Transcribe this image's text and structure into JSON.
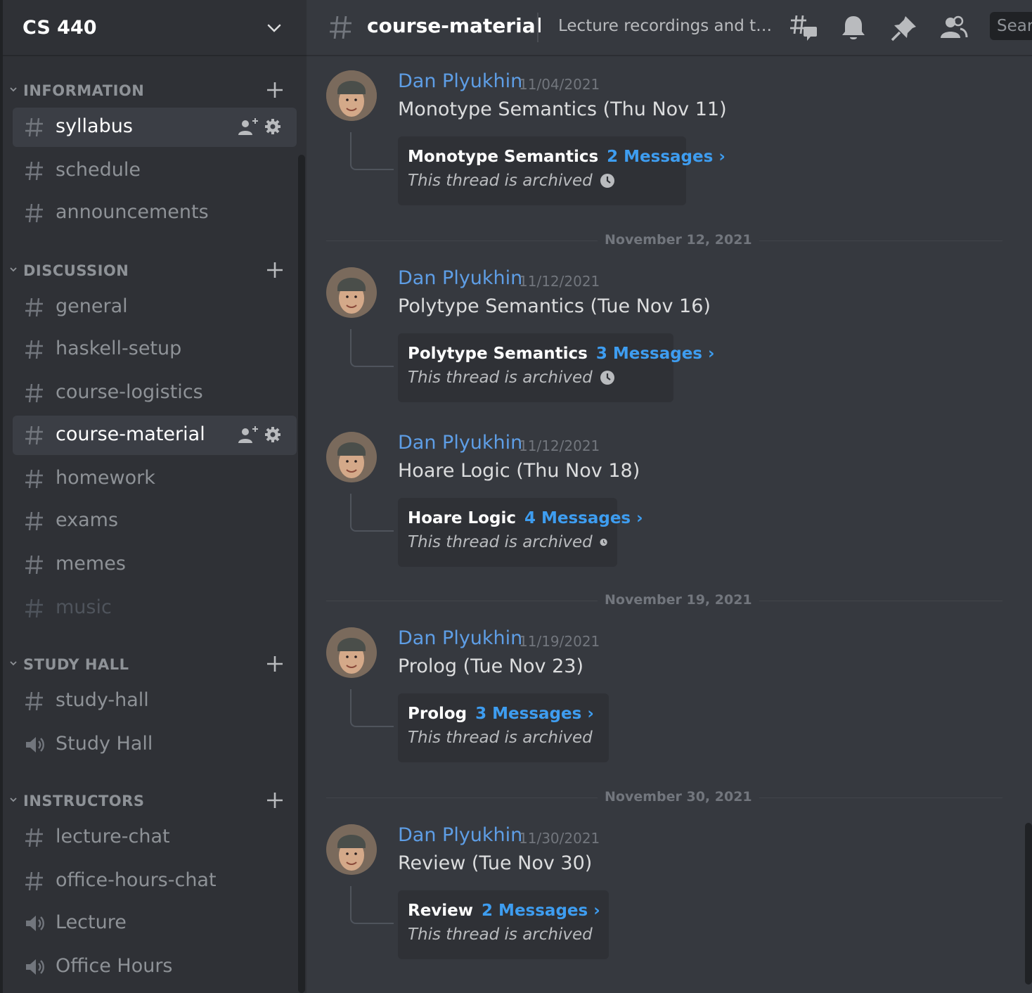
{
  "guild": {
    "name": "CS 440"
  },
  "sidebar": {
    "categories": [
      {
        "label": "INFORMATION",
        "channels": [
          {
            "label": "syllabus",
            "type": "text",
            "state": "selected"
          },
          {
            "label": "schedule",
            "type": "text"
          },
          {
            "label": "announcements",
            "type": "text"
          }
        ]
      },
      {
        "label": "DISCUSSION",
        "channels": [
          {
            "label": "general",
            "type": "text"
          },
          {
            "label": "haskell-setup",
            "type": "text"
          },
          {
            "label": "course-logistics",
            "type": "text"
          },
          {
            "label": "course-material",
            "type": "text",
            "state": "active"
          },
          {
            "label": "homework",
            "type": "text"
          },
          {
            "label": "exams",
            "type": "text"
          },
          {
            "label": "memes",
            "type": "text"
          },
          {
            "label": "music",
            "type": "text",
            "state": "muted"
          }
        ]
      },
      {
        "label": "STUDY HALL",
        "channels": [
          {
            "label": "study-hall",
            "type": "text"
          },
          {
            "label": "Study Hall",
            "type": "voice"
          }
        ]
      },
      {
        "label": "INSTRUCTORS",
        "channels": [
          {
            "label": "lecture-chat",
            "type": "text"
          },
          {
            "label": "office-hours-chat",
            "type": "text"
          },
          {
            "label": "Lecture",
            "type": "voice"
          },
          {
            "label": "Office Hours",
            "type": "voice"
          }
        ]
      }
    ]
  },
  "topbar": {
    "channel_name": "course-material",
    "topic": "Lecture recordings and topi...",
    "search_placeholder": "Search",
    "icons": [
      "threads-icon",
      "bell-icon",
      "pin-icon",
      "members-icon"
    ]
  },
  "messages": [
    {
      "author": "Dan Plyukhin",
      "timestamp": "11/04/2021",
      "content": "Monotype Semantics (Thu Nov 11)",
      "thread": {
        "name": "Monotype Semantics",
        "count": "2 Messages ›",
        "status": "This thread is archived"
      }
    },
    {
      "date_separator": "November 12, 2021"
    },
    {
      "author": "Dan Plyukhin",
      "timestamp": "11/12/2021",
      "content": "Polytype Semantics (Tue Nov 16)",
      "thread": {
        "name": "Polytype Semantics",
        "count": "3 Messages ›",
        "status": "This thread is archived"
      }
    },
    {
      "author": "Dan Plyukhin",
      "timestamp": "11/12/2021",
      "content": "Hoare Logic (Thu Nov 18)",
      "thread": {
        "name": "Hoare Logic",
        "count": "4 Messages ›",
        "status": "This thread is archived"
      }
    },
    {
      "date_separator": "November 19, 2021"
    },
    {
      "author": "Dan Plyukhin",
      "timestamp": "11/19/2021",
      "content": "Prolog (Tue Nov 23)",
      "thread": {
        "name": "Prolog",
        "count": "3 Messages ›",
        "status": "This thread is archived"
      }
    },
    {
      "date_separator": "November 30, 2021"
    },
    {
      "author": "Dan Plyukhin",
      "timestamp": "11/30/2021",
      "content": "Review (Tue Nov 30)",
      "thread": {
        "name": "Review",
        "count": "2 Messages ›",
        "status": "This thread is archived"
      }
    }
  ],
  "colors": {
    "accent": "#5e9ee6",
    "link": "#3e9df0",
    "background": "#36393f",
    "sidebar": "#2f3136"
  }
}
